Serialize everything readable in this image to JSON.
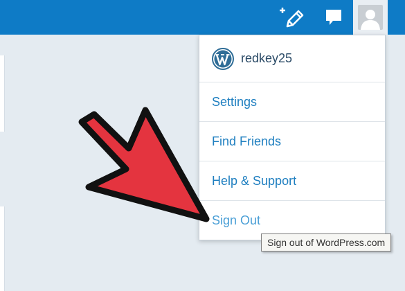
{
  "topbar": {
    "new_post_icon": "new-post-icon",
    "notifications_icon": "notifications-icon",
    "avatar_icon": "avatar-icon",
    "color": "#0e7bc6"
  },
  "menu": {
    "username": "redkey25",
    "items": [
      {
        "label": "Settings"
      },
      {
        "label": "Find Friends"
      },
      {
        "label": "Help & Support"
      },
      {
        "label": "Sign Out"
      }
    ]
  },
  "tooltip": {
    "text": "Sign out of WordPress.com"
  },
  "annotation": {
    "arrow_color": "#e4343f"
  }
}
